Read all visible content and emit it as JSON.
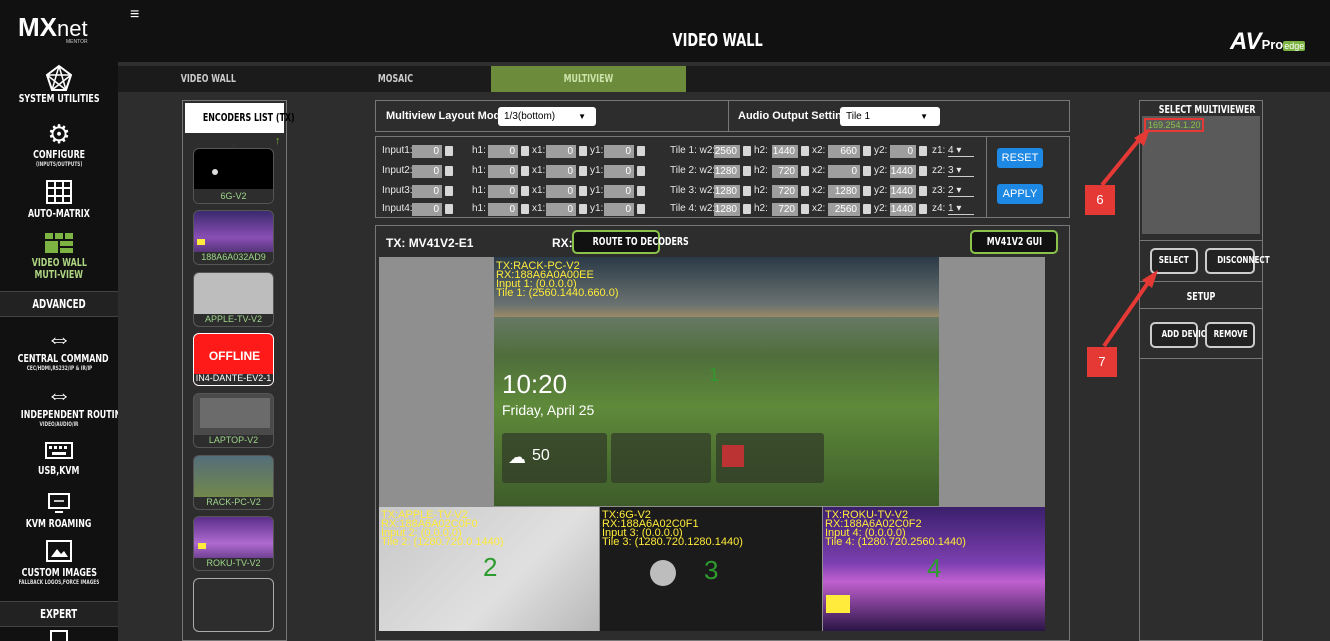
{
  "brand": {
    "logo_main": "MX",
    "logo_sub": "net",
    "logo_mentor": "MENTOR",
    "vendor_av": "AV",
    "vendor_pro": "Pro",
    "vendor_edge": "edge"
  },
  "header": {
    "title": "VIDEO WALL",
    "menu_icon": "hamburger-icon"
  },
  "sidebar": {
    "items": [
      {
        "label": "SYSTEM UTILITIES",
        "sub": "",
        "icon": "network-icon"
      },
      {
        "label": "CONFIGURE",
        "sub": "(INPUTS/OUTPUTS)",
        "icon": "gear-icon"
      },
      {
        "label": "AUTO-MATRIX",
        "sub": "",
        "icon": "grid-icon"
      },
      {
        "label": "VIDEO WALL",
        "label2": "MUTI-VIEW",
        "sub": "",
        "icon": "videowall-icon"
      }
    ],
    "section_advanced": "ADVANCED",
    "adv_items": [
      {
        "label": "CENTRAL COMMAND",
        "sub": "CEC/HDMI,RS232/IP & IR/IP",
        "icon": "arrows-icon"
      },
      {
        "label": "INDEPENDENT ROUTING",
        "sub": "VIDEO/AUDIO/IR",
        "icon": "arrows-icon"
      },
      {
        "label": "USB,KVM",
        "sub": "",
        "icon": "keyboard-icon"
      },
      {
        "label": "KVM ROAMING",
        "sub": "",
        "icon": "monitor-icon"
      },
      {
        "label": "CUSTOM IMAGES",
        "sub": "FALLBACK LOGOS,FORCE IMAGES",
        "icon": "image-icon"
      }
    ],
    "section_expert": "EXPERT"
  },
  "tabs": [
    "VIDEO WALL",
    "MOSAIC",
    "MULTIVIEW"
  ],
  "encoders": {
    "title": "ENCODERS LIST (TX)",
    "items": [
      "6G-V2",
      "188A6A032AD9",
      "APPLE-TV-V2",
      "IN4-DANTE-EV2-1",
      "LAPTOP-V2",
      "RACK-PC-V2",
      "ROKU-TV-V2"
    ],
    "offline_label": "OFFLINE"
  },
  "layout": {
    "mode_label": "Multiview Layout Mode:",
    "mode_value": "1/3(bottom)",
    "audio_label": "Audio Output Setting:",
    "audio_value": "Tile 1"
  },
  "inputs": [
    {
      "label": "Input1:",
      "w1": "0",
      "h1": "0",
      "x1": "0",
      "y1": "0"
    },
    {
      "label": "Input2:",
      "w1": "0",
      "h1": "0",
      "x1": "0",
      "y1": "0"
    },
    {
      "label": "Input3:",
      "w1": "0",
      "h1": "0",
      "x1": "0",
      "y1": "0"
    },
    {
      "label": "Input4:",
      "w1": "0",
      "h1": "0",
      "x1": "0",
      "y1": "0"
    }
  ],
  "tiles": [
    {
      "label": "Tile 1:",
      "w2": "2560",
      "h2": "1440",
      "x2": "660",
      "y2": "0",
      "z_label": "z1:",
      "z": "4"
    },
    {
      "label": "Tile 2:",
      "w2": "1280",
      "h2": "720",
      "x2": "0",
      "y2": "1440",
      "z_label": "z2:",
      "z": "3"
    },
    {
      "label": "Tile 3:",
      "w2": "1280",
      "h2": "720",
      "x2": "1280",
      "y2": "1440",
      "z_label": "z3:",
      "z": "2"
    },
    {
      "label": "Tile 4:",
      "w2": "1280",
      "h2": "720",
      "x2": "2560",
      "y2": "1440",
      "z_label": "z4:",
      "z": "1"
    }
  ],
  "field_labels": {
    "w1": "w1:",
    "h1": "h1:",
    "x1": "x1:",
    "y1": "y1:",
    "w2": "w2:",
    "h2": "h2:",
    "x2": "x2:",
    "y2": "y2:"
  },
  "buttons": {
    "reset": "RESET",
    "apply": "APPLY",
    "route": "ROUTE TO DECODERS",
    "gui": "MV41V2 GUI",
    "select": "SELECT",
    "disconnect": "DISCONNECT",
    "add_device": "ADD DEVICE",
    "remove": "REMOVE"
  },
  "preview": {
    "tx_label": "TX:",
    "tx_value": "MV41V2-E1",
    "rx_label": "RX:",
    "tile1": {
      "tx": "TX:RACK-PC-V2",
      "rx": "RX:188A6A0A00EE",
      "input": "Input 1: (0.0.0.0)",
      "tile": "Tile 1: (2560.1440.660.0)",
      "num": "1",
      "time": "10:20",
      "date": "Friday, April 25",
      "temp": "50"
    },
    "tile2": {
      "tx": "TX:APPLE-TV-V2",
      "rx": "RX:188A6A02C0F0",
      "input": "Input 2: (0.0.0.0)",
      "tile": "Tile 2: (1280.720.0.1440)",
      "num": "2"
    },
    "tile3": {
      "tx": "TX:6G-V2",
      "rx": "RX:188A6A02C0F1",
      "input": "Input 3: (0.0.0.0)",
      "tile": "Tile 3: (1280.720.1280.1440)",
      "num": "3"
    },
    "tile4": {
      "tx": "TX:ROKU-TV-V2",
      "rx": "RX:188A6A02C0F2",
      "input": "Input 4: (0.0.0.0)",
      "tile": "Tile 4: (1280.720.2560.1440)",
      "num": "4"
    }
  },
  "multiviewer": {
    "title": "SELECT MULTIVIEWER",
    "ip": "169.254.1.20",
    "setup": "SETUP"
  },
  "callouts": [
    "6",
    "7"
  ],
  "colors": {
    "accent_green": "#8bc34a",
    "button_blue": "#1e88e5",
    "callout_red": "#e53935",
    "offline_red": "#ff1a1a",
    "active_tab": "#6c8b3b"
  }
}
